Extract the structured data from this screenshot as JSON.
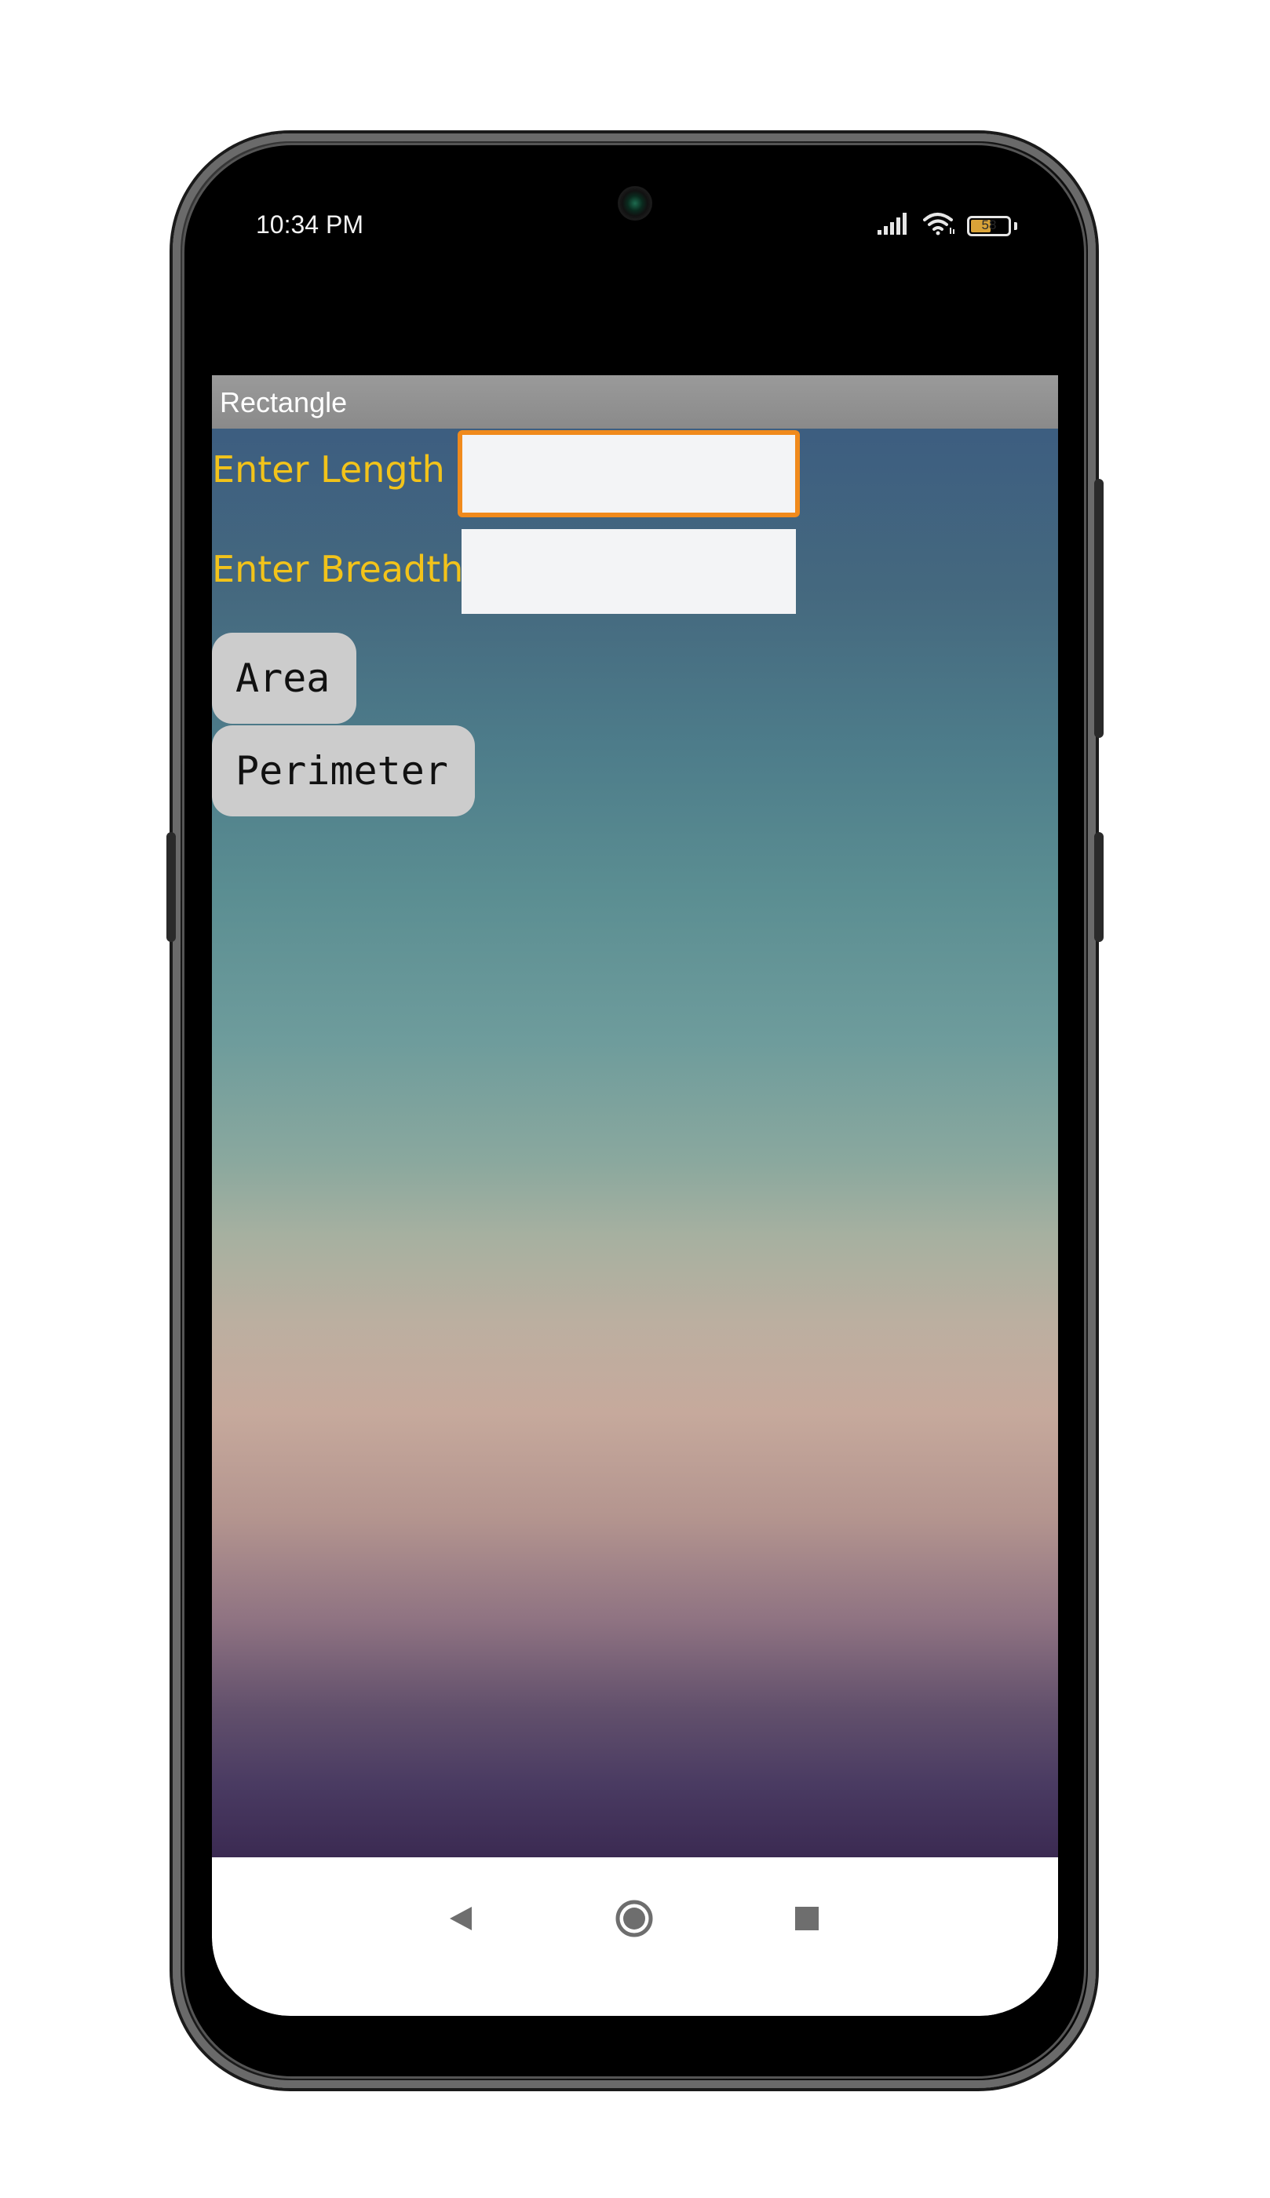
{
  "status_bar": {
    "time": "10:34 PM",
    "battery_level": "58",
    "battery_percent": 58
  },
  "app": {
    "title": "Rectangle",
    "length_label": "Enter Length",
    "breadth_label": "Enter Breadth",
    "length_value": "",
    "breadth_value": "",
    "area_button": "Area",
    "perimeter_button": "Perimeter"
  },
  "colors": {
    "label_color": "#f2c31a",
    "focus_border": "#f08a1c",
    "button_bg": "#cccccc",
    "title_bar_bg": "#9a9a9a"
  },
  "icons": {
    "signal": "signal-icon",
    "wifi": "wifi-icon",
    "battery": "battery-icon",
    "back": "back-triangle-icon",
    "home": "home-circle-icon",
    "recents": "recents-square-icon"
  }
}
